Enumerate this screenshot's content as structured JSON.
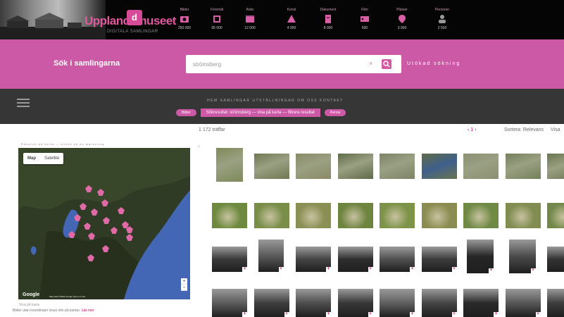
{
  "header": {
    "logo_text": "Upplandsmuseet",
    "logo_badge": "d",
    "logo_sub": "DIGITALA SAMLINGAR",
    "stats": [
      {
        "label": "Bilder",
        "icon": "camera-icon",
        "count": "250 000"
      },
      {
        "label": "Föremål",
        "icon": "object-icon",
        "count": "95 000"
      },
      {
        "label": "Arkiv",
        "icon": "archive-icon",
        "count": "12 000"
      },
      {
        "label": "Konst",
        "icon": "art-icon",
        "count": "4 000"
      },
      {
        "label": "Dokument",
        "icon": "document-icon",
        "count": "8 000"
      },
      {
        "label": "Film",
        "icon": "film-icon",
        "count": "600"
      },
      {
        "label": "Platser",
        "icon": "place-icon",
        "count": "3 000"
      },
      {
        "label": "Personer",
        "icon": "person-icon",
        "count": "2 500"
      }
    ]
  },
  "search": {
    "title": "Sök i samlingarna",
    "value": "strömsberg",
    "clear_icon": "×",
    "button_icon": "search-icon",
    "advanced_label": "Utökad sökning"
  },
  "nav": {
    "menu_icon": "menu-icon",
    "links": "HEM    SAMLINGAR    UTSTÄLLNINGAR    OM OSS    KONTAKT",
    "chip_left": "Bilder",
    "chip_main": "Sökresultat: strömsberg  —  visa på karta  —  filtrera resultat",
    "chip_right": "Rensa"
  },
  "results": {
    "count_label": "1 172 träffar",
    "pager": "‹ 1 ›",
    "sort_label": "Sortera: Relevans",
    "view_label": "Visa"
  },
  "map": {
    "caption": "Resultat på karta — klicka på en markering",
    "type_map": "Map",
    "type_satellite": "Satellite",
    "zoom_in": "+",
    "zoom_out": "−",
    "google_label": "Google",
    "footer": "Map data ©2018 Google   Terms of Use",
    "note": "Visa på karta",
    "info": "Bilder utan koordinater visas inte på kartan.",
    "info_link": "Läs mer",
    "pin_color": "#e06aa8",
    "water_color": "#4366b5"
  },
  "grid": {
    "accent": "#c06",
    "collapse_icon": "‹",
    "rows": [
      {
        "kind": "aerial",
        "photos": [
          "aerial",
          "aerial",
          "aerial",
          "aerial",
          "aerial",
          "aerial",
          "aerial",
          "aerial",
          "aerial"
        ]
      },
      {
        "kind": "aerial-green",
        "photos": [
          "aerial",
          "aerial",
          "aerial",
          "aerial",
          "aerial",
          "aerial",
          "aerial",
          "aerial",
          "aerial"
        ]
      },
      {
        "kind": "bw",
        "photos": [
          "bw",
          "bw",
          "bw",
          "bw",
          "bw",
          "bw",
          "bw",
          "bw",
          "bw"
        ]
      },
      {
        "kind": "bw",
        "photos": [
          "bw",
          "bw",
          "bw",
          "bw",
          "bw",
          "bw",
          "bw",
          "bw",
          "bw"
        ]
      }
    ]
  }
}
